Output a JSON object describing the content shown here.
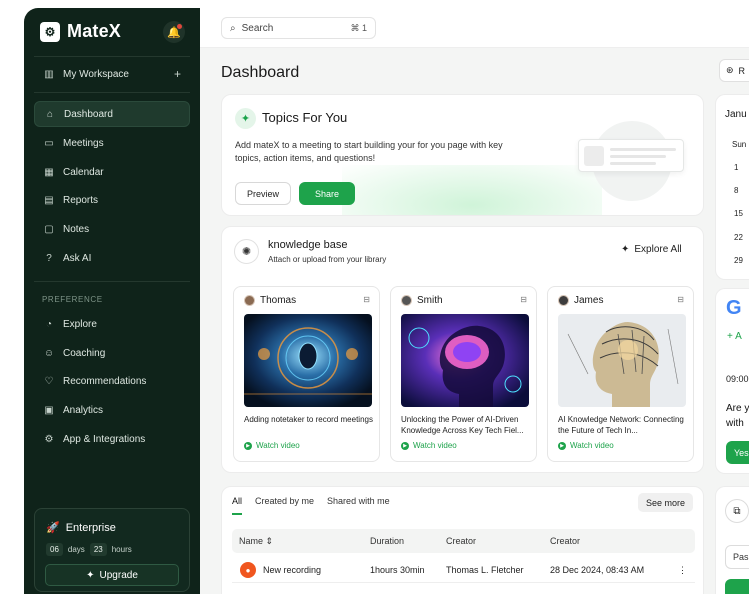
{
  "app": {
    "name": "MateX"
  },
  "sidebar": {
    "workspace": "My Workspace",
    "items": [
      {
        "label": "Dashboard"
      },
      {
        "label": "Meetings"
      },
      {
        "label": "Calendar"
      },
      {
        "label": "Reports"
      },
      {
        "label": "Notes"
      },
      {
        "label": "Ask AI"
      }
    ],
    "preference_label": "PREFERENCE",
    "preference_items": [
      {
        "label": "Explore"
      },
      {
        "label": "Coaching"
      },
      {
        "label": "Recommendations"
      },
      {
        "label": "Analytics"
      },
      {
        "label": "App & Integrations"
      }
    ],
    "enterprise": {
      "title": "Enterprise",
      "days_value": "06",
      "days_label": "days",
      "hours_value": "23",
      "hours_label": "hours",
      "upgrade_label": "Upgrade"
    }
  },
  "topbar": {
    "search_placeholder": "Search",
    "search_shortcut": "⌘ 1"
  },
  "main": {
    "title": "Dashboard",
    "topics": {
      "title": "Topics For You",
      "description": "Add mateX to a meeting to start building your for you page with key topics, action items, and questions!",
      "preview_label": "Preview",
      "share_label": "Share"
    },
    "knowledge": {
      "title": "knowledge base",
      "subtitle": "Attach or upload from your library",
      "explore_label": "Explore All",
      "videos": [
        {
          "author": "Thomas",
          "title": "Adding notetaker to record meetings",
          "watch": "Watch video"
        },
        {
          "author": "Smith",
          "title": "Unlocking the Power of AI-Driven Knowledge Across Key Tech Fiel...",
          "watch": "Watch video"
        },
        {
          "author": "James",
          "title": "AI Knowledge Network: Connecting the Future of Tech In...",
          "watch": "Watch video"
        }
      ]
    },
    "recordings": {
      "tabs": [
        "All",
        "Created by me",
        "Shared with me"
      ],
      "see_more": "See more",
      "columns": [
        "Name",
        "Duration",
        "Creator",
        "Creator"
      ],
      "rows": [
        {
          "name": "New recording",
          "duration": "1hours 30min",
          "creator": "Thomas L. Fletcher",
          "date": "28 Dec 2024, 08:43 AM"
        }
      ]
    }
  },
  "right": {
    "button_label": "R",
    "calendar": {
      "month": "Janu",
      "dow": "Sun",
      "days": [
        "1",
        "8",
        "15",
        "22",
        "29"
      ]
    },
    "google": {
      "logo": "G",
      "add_label": "A",
      "time": "09:00",
      "text_line1": "Are y",
      "text_line2": "with",
      "yes_label": "Yes"
    },
    "panel": {
      "input_text": "Pas"
    }
  }
}
